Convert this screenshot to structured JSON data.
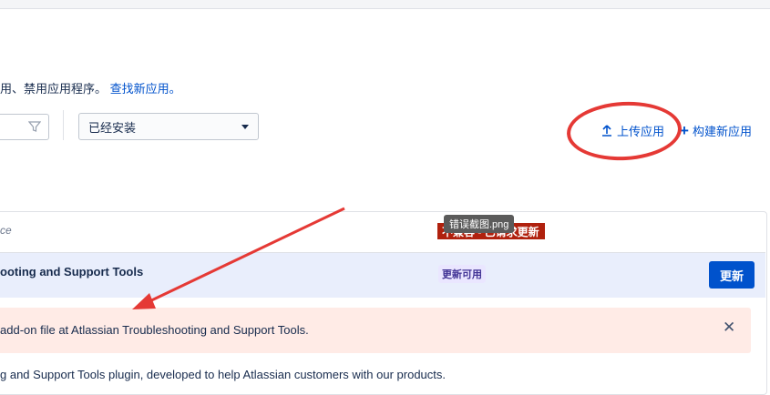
{
  "description": {
    "text": "用、禁用应用程序。",
    "link": "查找新应用。"
  },
  "filter": {
    "icon": "filter-icon",
    "select_value": "已经安装"
  },
  "actions": {
    "upload_label": "上传应用",
    "upload_icon": "upload-arrow-icon",
    "build_label": "构建新应用",
    "build_icon": "plus-icon"
  },
  "plugin": {
    "header_text": "ce",
    "name": "ooting and Support Tools",
    "badge": "更新可用",
    "update_button": "更新",
    "error_message": "add-on file at Atlassian Troubleshooting and Support Tools.",
    "description": "g and Support Tools plugin, developed to help Atlassian customers with our products."
  },
  "annotations": {
    "overlay_label": "不兼容 - 已请求更新",
    "tooltip": "错误截图.png",
    "ellipse_color": "#e53935",
    "arrow_color": "#e53935"
  }
}
